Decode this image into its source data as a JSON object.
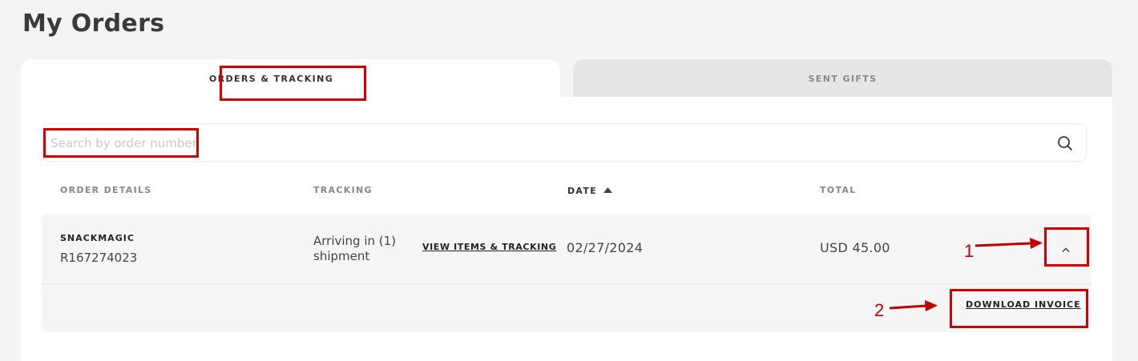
{
  "page": {
    "title": "My Orders"
  },
  "tabs": [
    {
      "label": "ORDERS & TRACKING",
      "active": true
    },
    {
      "label": "SENT GIFTS",
      "active": false
    }
  ],
  "search": {
    "placeholder": "Search by order number",
    "value": "",
    "icon": "search-icon"
  },
  "table": {
    "columns": [
      "ORDER DETAILS",
      "TRACKING",
      "DATE",
      "TOTAL"
    ],
    "sort": {
      "column": "DATE",
      "direction": "ascending",
      "icon": "sort-up-triangle-icon"
    },
    "rows": [
      {
        "merchant": "SNACKMAGIC",
        "order_number": "R167274023",
        "tracking_status": "Arriving in (1) shipment",
        "tracking_link": "VIEW ITEMS & TRACKING",
        "date": "02/27/2024",
        "total": "USD 45.00",
        "expand_icon": "chevron-up-icon",
        "invoice_link": "DOWNLOAD INVOICE"
      }
    ]
  },
  "annotations": {
    "color": "#d40000",
    "steps": [
      {
        "number": "1"
      },
      {
        "number": "2"
      }
    ]
  }
}
